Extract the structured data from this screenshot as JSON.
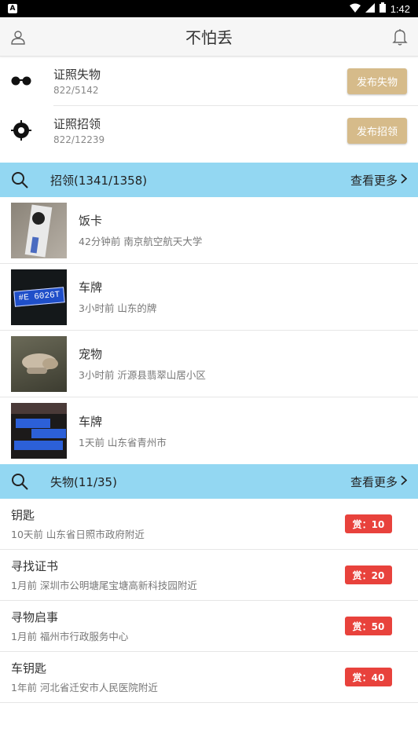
{
  "status_bar": {
    "time": "1:42",
    "notif_letter": "A"
  },
  "app_bar": {
    "title": "不怕丢",
    "profile_icon": "person-icon",
    "bell_icon": "bell-icon"
  },
  "post_rows": [
    {
      "name": "证照失物",
      "stat": "822/5142",
      "button": "发布失物",
      "icon": "glasses-icon"
    },
    {
      "name": "证照招领",
      "stat": "822/12239",
      "button": "发布招领",
      "icon": "target-icon"
    }
  ],
  "found_section": {
    "label": "招领(1341/1358)",
    "more": "查看更多",
    "items": [
      {
        "title": "饭卡",
        "meta": "42分钟前 南京航空航天大学",
        "thumb": "card-photo"
      },
      {
        "title": "车牌",
        "meta": "3小时前 山东的牌",
        "thumb": "license-plate-photo",
        "plate": "#E 6026T"
      },
      {
        "title": "宠物",
        "meta": "3小时前 沂源县翡翠山居小区",
        "thumb": "dog-photo"
      },
      {
        "title": "车牌",
        "meta": "1天前 山东省青州市",
        "thumb": "plates-photo"
      }
    ]
  },
  "lost_section": {
    "label": "失物(11/35)",
    "more": "查看更多",
    "items": [
      {
        "title": "钥匙",
        "meta": "10天前 山东省日照市政府附近",
        "reward": "赏：10"
      },
      {
        "title": "寻找证书",
        "meta": "1月前 深圳市公明塘尾宝塘高新科技园附近",
        "reward": "赏：20"
      },
      {
        "title": "寻物启事",
        "meta": "1月前 福州市行政服务中心",
        "reward": "赏：50"
      },
      {
        "title": "车钥匙",
        "meta": "1年前 河北省迁安市人民医院附近",
        "reward": "赏：40"
      }
    ]
  },
  "colors": {
    "section_head": "#93d7f2",
    "post_button": "#d6bb8a",
    "reward": "#e8423c"
  }
}
